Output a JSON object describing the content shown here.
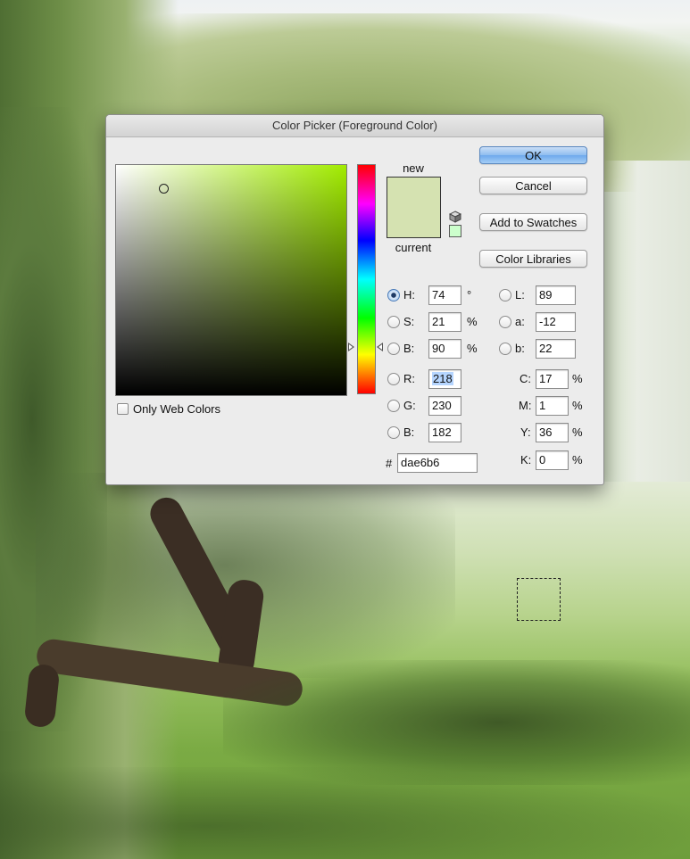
{
  "dialog": {
    "title": "Color Picker (Foreground Color)",
    "buttons": {
      "ok": "OK",
      "cancel": "Cancel",
      "add_to_swatches": "Add to Swatches",
      "color_libraries": "Color Libraries"
    },
    "preview": {
      "new_label": "new",
      "current_label": "current",
      "new_color": "#d5e2b1",
      "current_color": "#d5e2b1",
      "websafe_color": "#ccffcc"
    },
    "field": {
      "hue_color": "#a2ec00"
    },
    "only_web_colors_label": "Only Web Colors",
    "hsb": [
      {
        "key": "H",
        "label": "H:",
        "value": "74",
        "unit": "°",
        "selected": true
      },
      {
        "key": "S",
        "label": "S:",
        "value": "21",
        "unit": "%"
      },
      {
        "key": "Br",
        "label": "B:",
        "value": "90",
        "unit": "%"
      }
    ],
    "rgb": [
      {
        "key": "R",
        "label": "R:",
        "value": "218"
      },
      {
        "key": "G",
        "label": "G:",
        "value": "230"
      },
      {
        "key": "Bl",
        "label": "B:",
        "value": "182"
      }
    ],
    "lab": [
      {
        "key": "L",
        "label": "L:",
        "value": "89"
      },
      {
        "key": "a",
        "label": "a:",
        "value": "-12"
      },
      {
        "key": "b",
        "label": "b:",
        "value": "22"
      }
    ],
    "cmyk": [
      {
        "key": "C",
        "label": "C:",
        "value": "17",
        "unit": "%"
      },
      {
        "key": "M",
        "label": "M:",
        "value": "1",
        "unit": "%"
      },
      {
        "key": "Y",
        "label": "Y:",
        "value": "36",
        "unit": "%"
      },
      {
        "key": "K",
        "label": "K:",
        "value": "0",
        "unit": "%"
      }
    ],
    "hex": {
      "label": "#",
      "value": "dae6b6"
    }
  },
  "colors": {
    "accent_button": "#8fbdf0"
  }
}
